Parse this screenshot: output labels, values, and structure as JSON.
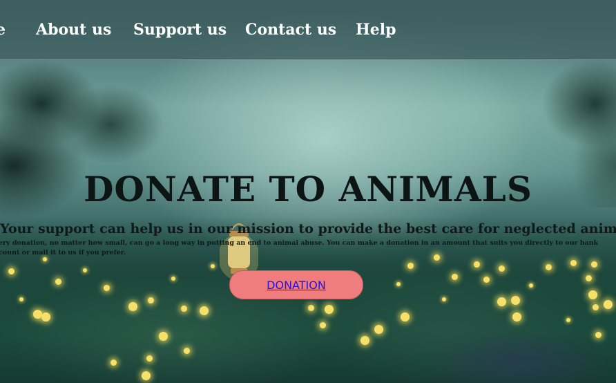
{
  "nav": {
    "items": [
      {
        "label": "e"
      },
      {
        "label": "About us"
      },
      {
        "label": "Support us"
      },
      {
        "label": "Contact us"
      },
      {
        "label": "Help"
      }
    ]
  },
  "hero": {
    "title": "DONATE TO ANIMALS",
    "subtitle": "Your support can help us in our mission to provide the best care for neglected animals.",
    "body_line1": "ery donation, no matter how small, can go a long way in putting an end to animal abuse. You can make a donation in an amount that suits you directly to our bank",
    "body_line2": "count or mail it to us if you prefer.",
    "button_label": "DONATION"
  },
  "colors": {
    "button_bg": "#ef7d7d",
    "button_text": "#2a12d8",
    "nav_text": "#ffffff",
    "title_text": "#0d1414"
  }
}
